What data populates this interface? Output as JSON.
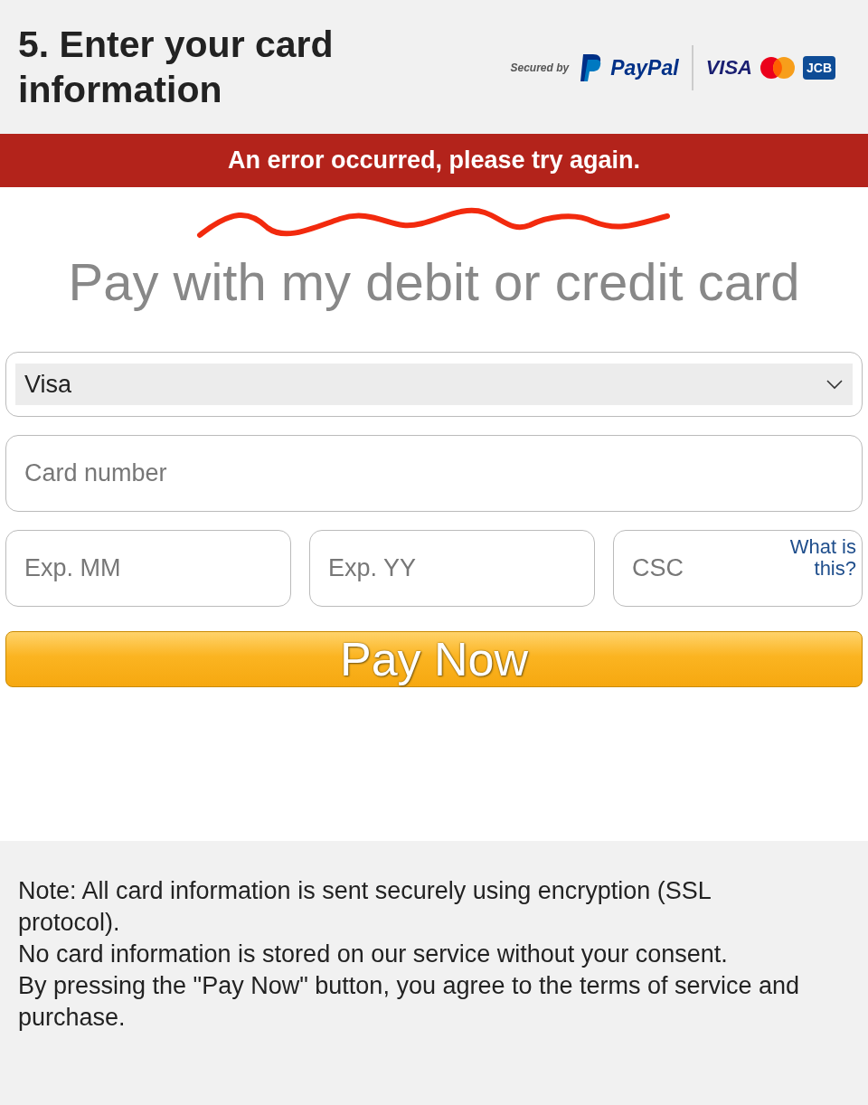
{
  "header": {
    "title": "5. Enter your card information",
    "secured_by": "Secured by",
    "paypal": "PayPal",
    "visa": "VISA",
    "jcb": "JCB"
  },
  "error_banner": "An error occurred, please try again.",
  "heading": "Pay with my debit or credit card",
  "card_type": {
    "value": "Visa"
  },
  "card_number": {
    "placeholder": "Card number"
  },
  "fields": [
    {
      "placeholder": "Exp. MM"
    },
    {
      "placeholder": "Exp. YY"
    },
    {
      "placeholder": "CSC",
      "help_link": "What is this?"
    }
  ],
  "pay_button": "Pay Now",
  "notes": [
    "Note: All card information is sent securely using encryption (SSL protocol).",
    "No card information is stored on our service without your consent.",
    "By pressing the \"Pay Now\" button, you agree to the terms of service and purchase."
  ]
}
